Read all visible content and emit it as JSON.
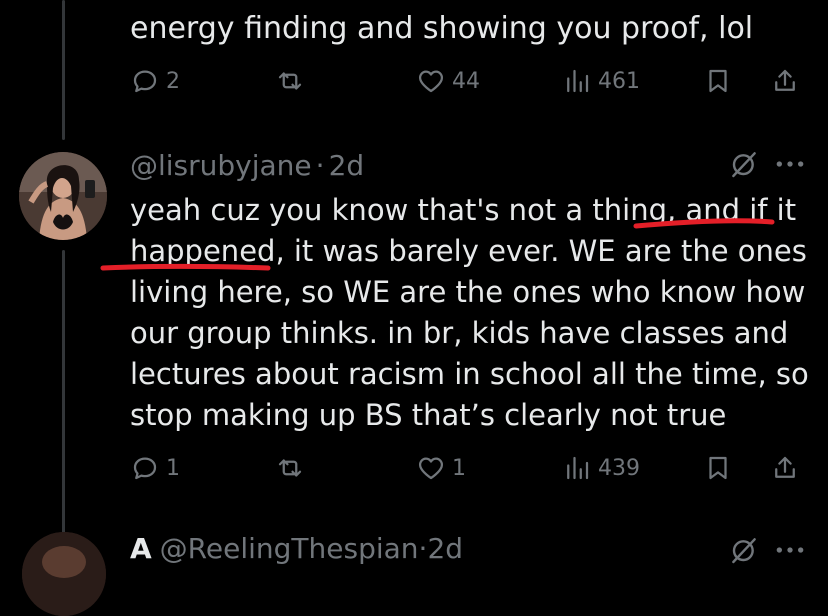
{
  "previous_tweet": {
    "text_tail": "energy finding and showing you proof, lol",
    "replies": "2",
    "likes": "44",
    "views": "461"
  },
  "tweet": {
    "handle": "@lisrubyjane",
    "separator": "·",
    "time": "2d",
    "lines": [
      "yeah cuz you know that's not a thing, and if it",
      "happened, it was barely ever. WE are the ones",
      "living here, so WE are the ones who know how",
      "our group thinks. in br, kids have classes and",
      "lectures about racism in school all the time, so",
      "stop making up BS that’s clearly not true"
    ],
    "replies": "1",
    "likes": "1",
    "views": "439"
  },
  "next_tweet": {
    "name": "A",
    "handle": "@ReelingThespian",
    "separator": "·",
    "time": "2d"
  },
  "colors": {
    "background": "#000000",
    "text": "#e7e9ea",
    "muted": "#71767b",
    "annotation": "#e41f28"
  },
  "icons": [
    "reply-icon",
    "retweet-icon",
    "like-icon",
    "views-icon",
    "bookmark-icon",
    "share-icon",
    "grok-icon",
    "more-icon"
  ]
}
